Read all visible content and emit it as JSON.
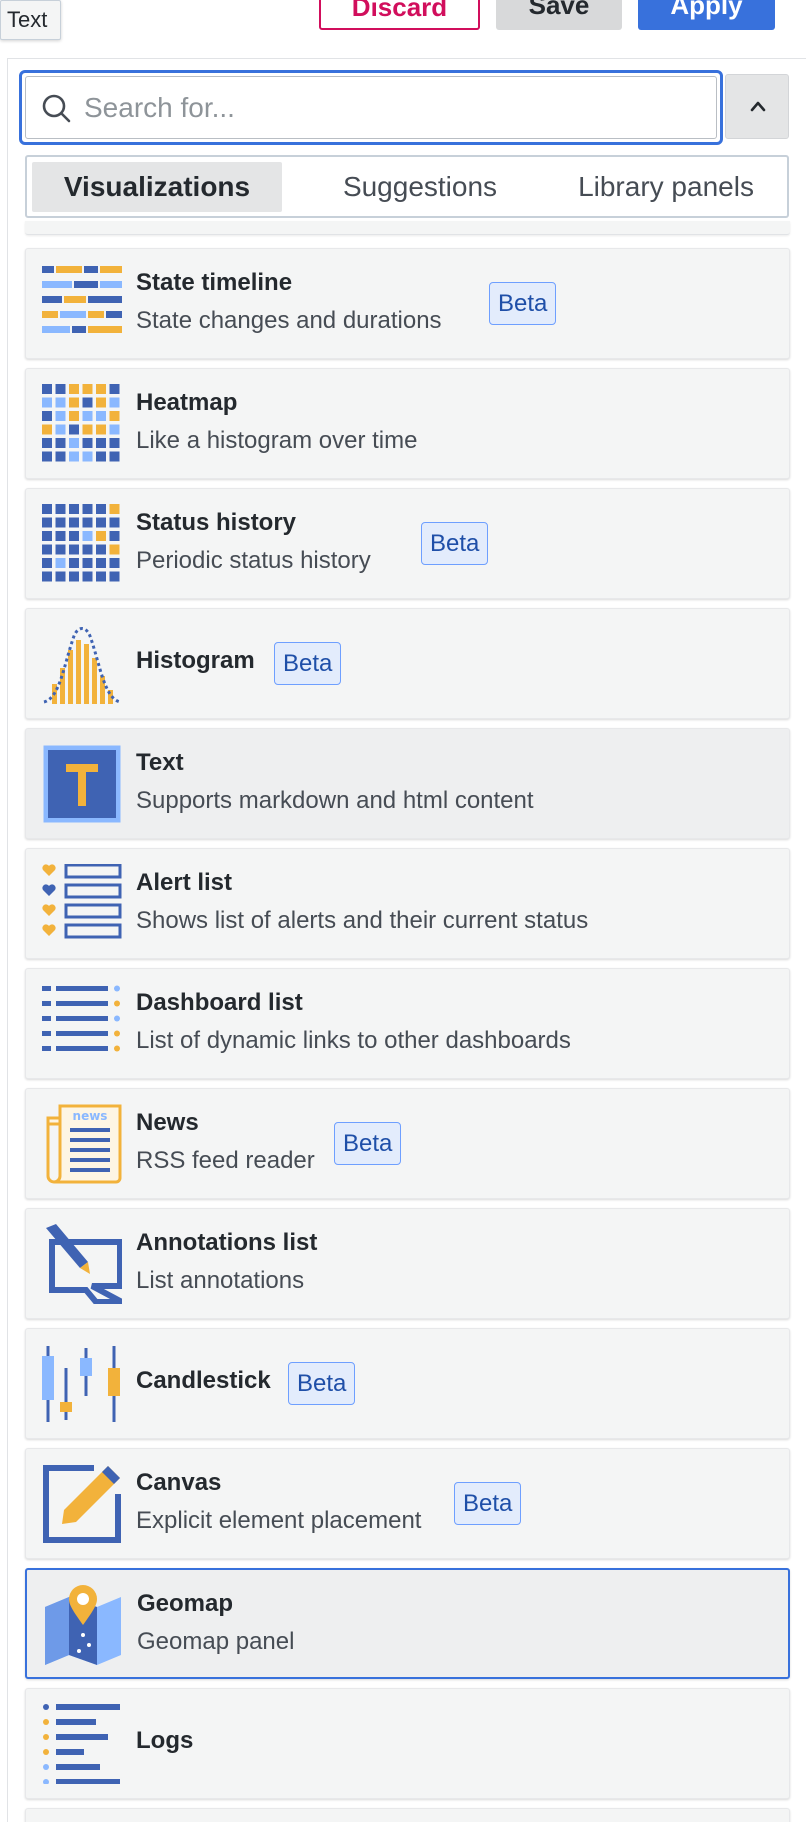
{
  "tooltip": "Text",
  "toolbar": {
    "discard_label": "Discard",
    "save_label": "Save",
    "apply_label": "Apply"
  },
  "search": {
    "placeholder": "Search for...",
    "value": ""
  },
  "tabs": [
    {
      "label": "Visualizations",
      "active": true
    },
    {
      "label": "Suggestions",
      "active": false
    },
    {
      "label": "Library panels",
      "active": false
    }
  ],
  "colors": {
    "accent_blue": "#3871dc",
    "icon_blue": "#3f63b3",
    "icon_light_blue": "#8ab8ff",
    "icon_orange": "#f2b23b",
    "danger": "#d10e5c"
  },
  "visualizations": [
    {
      "name": "State timeline",
      "description": "State changes and durations",
      "badge": "Beta",
      "icon": "state-timeline-icon"
    },
    {
      "name": "Heatmap",
      "description": "Like a histogram over time",
      "badge": "",
      "icon": "heatmap-icon"
    },
    {
      "name": "Status history",
      "description": "Periodic status history",
      "badge": "Beta",
      "icon": "status-history-icon"
    },
    {
      "name": "Histogram",
      "description": "",
      "badge": "Beta",
      "icon": "histogram-icon"
    },
    {
      "name": "Text",
      "description": "Supports markdown and html content",
      "badge": "",
      "icon": "text-icon",
      "hovered": true
    },
    {
      "name": "Alert list",
      "description": "Shows list of alerts and their current status",
      "badge": "",
      "icon": "alert-list-icon"
    },
    {
      "name": "Dashboard list",
      "description": "List of dynamic links to other dashboards",
      "badge": "",
      "icon": "dashboard-list-icon"
    },
    {
      "name": "News",
      "description": "RSS feed reader",
      "badge": "Beta",
      "icon": "news-icon",
      "icon_text": "news"
    },
    {
      "name": "Annotations list",
      "description": "List annotations",
      "badge": "",
      "icon": "annotations-list-icon"
    },
    {
      "name": "Candlestick",
      "description": "",
      "badge": "Beta",
      "icon": "candlestick-icon"
    },
    {
      "name": "Canvas",
      "description": "Explicit element placement",
      "badge": "Beta",
      "icon": "canvas-icon"
    },
    {
      "name": "Geomap",
      "description": "Geomap panel",
      "badge": "",
      "icon": "geomap-icon",
      "selected": true
    },
    {
      "name": "Logs",
      "description": "",
      "badge": "",
      "icon": "logs-icon"
    }
  ]
}
